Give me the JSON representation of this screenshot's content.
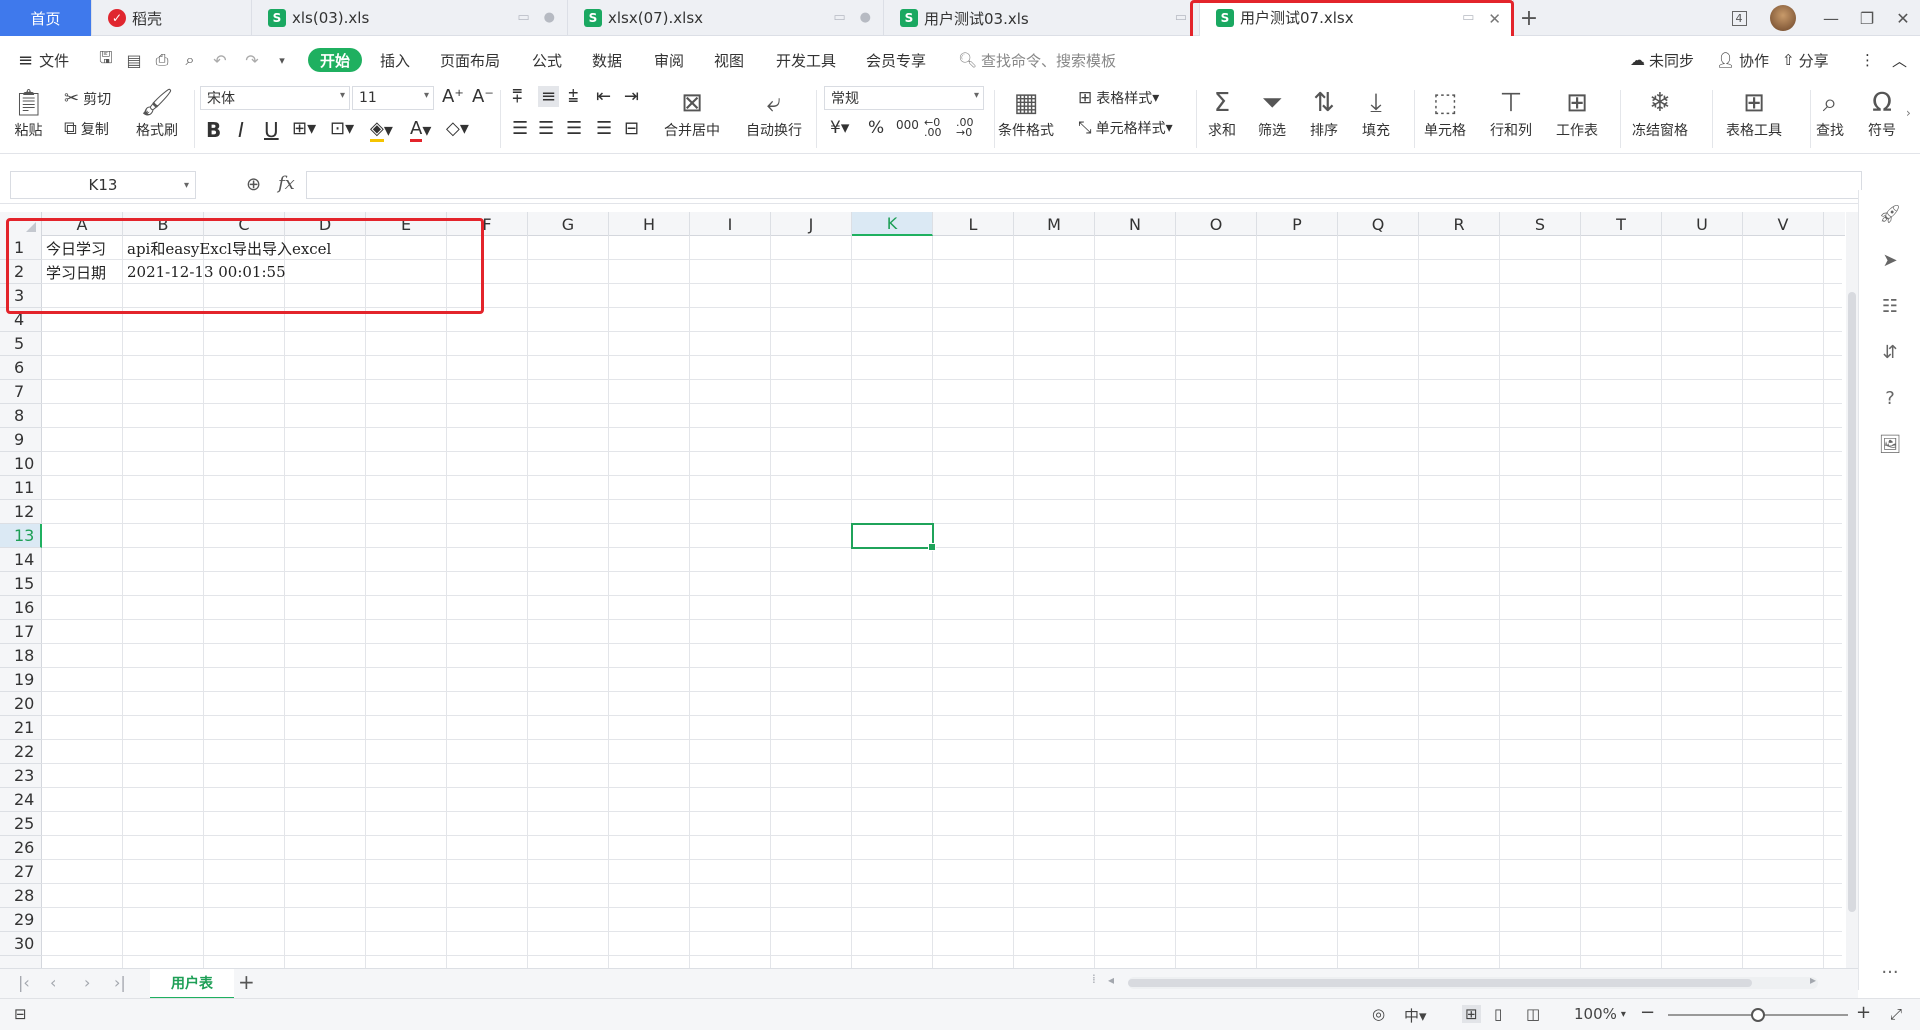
{
  "tabs": {
    "home": "首页",
    "items": [
      {
        "label": "稻壳",
        "icon": "daoke-logo-icon"
      },
      {
        "label": "xls(03).xls",
        "icon": "spreadsheet-file-icon"
      },
      {
        "label": "xlsx(07).xlsx",
        "icon": "spreadsheet-file-icon"
      },
      {
        "label": "用户测试03.xls",
        "icon": "spreadsheet-file-icon"
      },
      {
        "label": "用户测试07.xlsx",
        "icon": "spreadsheet-file-icon",
        "active": true
      }
    ],
    "add": "+",
    "window_count": "4"
  },
  "menu": {
    "file": "文件",
    "items": [
      "开始",
      "插入",
      "页面布局",
      "公式",
      "数据",
      "审阅",
      "视图",
      "开发工具",
      "会员专享"
    ],
    "active": "开始",
    "search_placeholder": "查找命令、搜索模板",
    "unsynced": "未同步",
    "collab": "协作",
    "share": "分享"
  },
  "ribbon": {
    "paste": "粘贴",
    "cut": "剪切",
    "copy": "复制",
    "format_painter": "格式刷",
    "font_name": "宋体",
    "font_size": "11",
    "bold": "B",
    "italic": "I",
    "underline": "U",
    "merge_center": "合并居中",
    "wrap_text": "自动换行",
    "number_format": "常规",
    "percent": "%",
    "thousands": "000",
    "decimal_inc": "←0 .00",
    "decimal_dec": ".00 →0",
    "table_style": "表格样式",
    "conditional_format": "条件格式",
    "cell_style": "单元格样式",
    "sum": "求和",
    "filter": "筛选",
    "sort": "排序",
    "fill": "填充",
    "cells": "单元格",
    "rows_cols": "行和列",
    "worksheet": "工作表",
    "freeze": "冻结窗格",
    "table_tools": "表格工具",
    "find": "查找",
    "symbol": "符号"
  },
  "formula_bar": {
    "name_box": "K13",
    "fx": "fx",
    "value": ""
  },
  "grid": {
    "columns": [
      "A",
      "B",
      "C",
      "D",
      "E",
      "F",
      "G",
      "H",
      "I",
      "J",
      "K",
      "L",
      "M",
      "N",
      "O",
      "P",
      "Q",
      "R",
      "S",
      "T",
      "U",
      "V"
    ],
    "rows": [
      "1",
      "2",
      "3",
      "4",
      "5",
      "6",
      "7",
      "8",
      "9",
      "10",
      "11",
      "12",
      "13",
      "14",
      "15",
      "16",
      "17",
      "18",
      "19",
      "20",
      "21",
      "22",
      "23",
      "24",
      "25",
      "26",
      "27",
      "28",
      "29",
      "30"
    ],
    "selected_column": "K",
    "selected_row": "13",
    "cells": {
      "A1": "今日学习",
      "B1": "api和easyExcl导出导入excel",
      "A2": "学习日期",
      "B2": "2021-12-13 00:01:55"
    }
  },
  "sheets": {
    "active": "用户表",
    "add": "+"
  },
  "status": {
    "zoom": "100%",
    "zoom_level": 0.5
  },
  "colors": {
    "accent_green": "#1fb060",
    "home_tab_blue": "#3f79ec",
    "annotation_red": "#e3242b"
  }
}
